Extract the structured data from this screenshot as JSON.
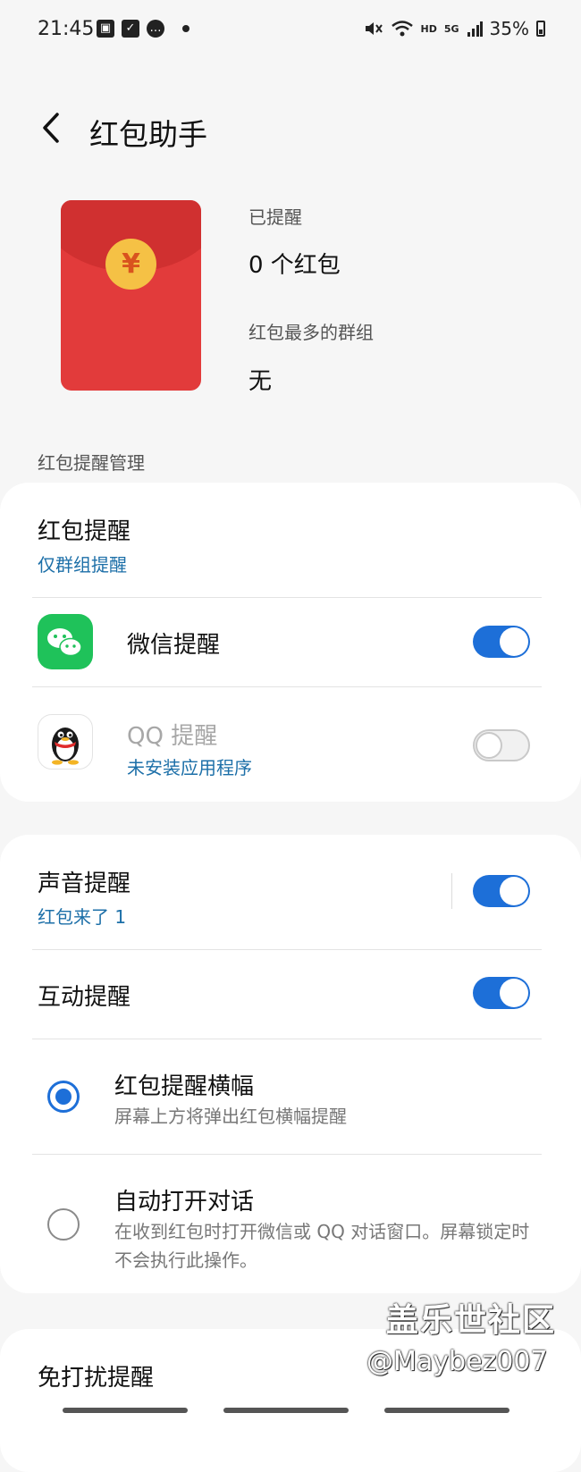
{
  "status_bar": {
    "time": "21:45",
    "left_icons": [
      "image-icon",
      "checkbox-icon",
      "chat-bubble-icon",
      "dot-icon"
    ],
    "network_badge": "HD",
    "signal_badge": "5G",
    "battery_text": "35%"
  },
  "header": {
    "title": "红包助手",
    "back_icon": "chevron-left-icon"
  },
  "summary": {
    "reminded_label": "已提醒",
    "reminded_value": "0 个红包",
    "top_group_label": "红包最多的群组",
    "top_group_value": "无",
    "envelope_symbol": "¥"
  },
  "section_header": "红包提醒管理",
  "card1": {
    "red_packet_reminder": {
      "title": "红包提醒",
      "subtitle": "仅群组提醒"
    },
    "wechat": {
      "title": "微信提醒",
      "enabled": true
    },
    "qq": {
      "title": "QQ 提醒",
      "subtitle": "未安装应用程序",
      "enabled": false
    }
  },
  "card2": {
    "sound": {
      "title": "声音提醒",
      "subtitle": "红包来了 1",
      "enabled": true
    },
    "interactive": {
      "title": "互动提醒",
      "enabled": true
    },
    "options": [
      {
        "title": "红包提醒横幅",
        "desc": "屏幕上方将弹出红包横幅提醒",
        "selected": true
      },
      {
        "title": "自动打开对话",
        "desc": "在收到红包时打开微信或 QQ 对话窗口。屏幕锁定时不会执行此操作。",
        "selected": false
      }
    ]
  },
  "card3": {
    "title": "免打扰提醒"
  },
  "watermark": {
    "line1": "盖乐世社区",
    "line2": "@Maybez007"
  },
  "colors": {
    "accent": "#1d6fd8",
    "link": "#1c6fa8",
    "envelope": "#e23b3b",
    "coin": "#f5c145",
    "wechat": "#1fc25a"
  }
}
